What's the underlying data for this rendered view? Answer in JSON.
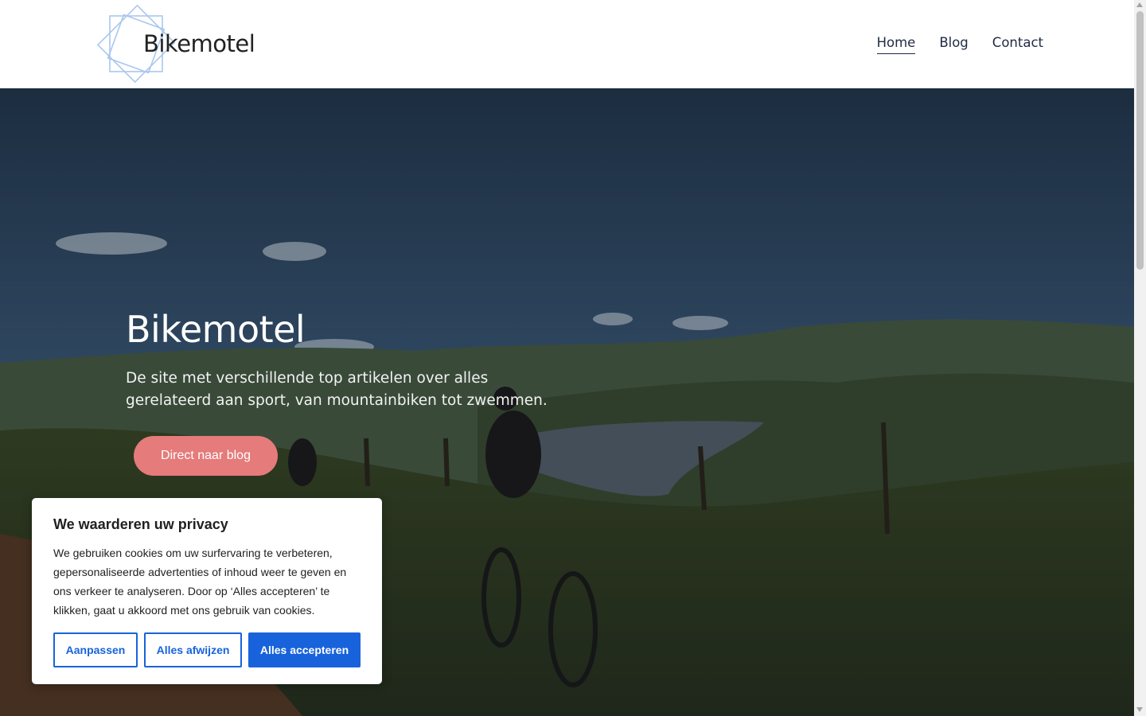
{
  "header": {
    "brand": "Bikemotel",
    "logo_icon": "octagram-logo-icon",
    "nav": [
      {
        "label": "Home",
        "active": true
      },
      {
        "label": "Blog",
        "active": false
      },
      {
        "label": "Contact",
        "active": false
      }
    ]
  },
  "hero": {
    "title": "Bikemotel",
    "subtitle": "De site met verschillende top artikelen over alles gerelateerd aan sport, van mountainbiken tot zwemmen.",
    "cta_label": "Direct naar blog",
    "cta_color": "#e57b7b"
  },
  "cookie": {
    "title": "We waarderen uw privacy",
    "text": "We gebruiken cookies om uw surfervaring te verbeteren, gepersonaliseerde advertenties of inhoud weer te geven en ons verkeer te analyseren. Door op ‘Alles accepteren’ te klikken, gaat u akkoord met ons gebruik van cookies.",
    "buttons": {
      "customize": "Aanpassen",
      "reject": "Alles afwijzen",
      "accept": "Alles accepteren"
    },
    "accent_color": "#1863dc"
  }
}
